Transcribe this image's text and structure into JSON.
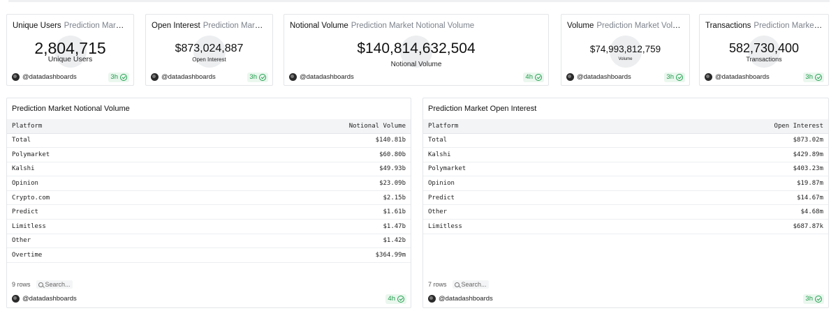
{
  "kpis": [
    {
      "title": "Unique Users",
      "subtitle": "Prediction Market Us...",
      "value": "2,804,715",
      "label": "Unique Users",
      "author": "@datadashboards",
      "freshness": "3h"
    },
    {
      "title": "Open Interest",
      "subtitle": "Prediction Market O...",
      "value": "$873,024,887",
      "label": "Open Interest",
      "author": "@datadashboards",
      "freshness": "3h"
    },
    {
      "title": "Notional Volume",
      "subtitle": "Prediction Market Notional Volume",
      "value": "$140,814,632,504",
      "label": "Notional Volume",
      "author": "@datadashboards",
      "freshness": "4h"
    },
    {
      "title": "Volume",
      "subtitle": "Prediction Market Volume",
      "value": "$74,993,812,759",
      "label": "Volume",
      "author": "@datadashboards",
      "freshness": "3h"
    },
    {
      "title": "Transactions",
      "subtitle": "Prediction Market Tra...",
      "value": "582,730,400",
      "label": "Transactions",
      "author": "@datadashboards",
      "freshness": "3h"
    }
  ],
  "tables": [
    {
      "title": "Prediction Market Notional Volume",
      "columns": [
        "Platform",
        "Notional Volume"
      ],
      "rows": [
        [
          "Total",
          "$140.81b"
        ],
        [
          "Polymarket",
          "$60.80b"
        ],
        [
          "Kalshi",
          "$49.93b"
        ],
        [
          "Opinion",
          "$23.09b"
        ],
        [
          "Crypto.com",
          "$2.15b"
        ],
        [
          "Predict",
          "$1.61b"
        ],
        [
          "Limitless",
          "$1.47b"
        ],
        [
          "Other",
          "$1.42b"
        ],
        [
          "Overtime",
          "$364.99m"
        ]
      ],
      "row_count": "9 rows",
      "search_placeholder": "Search...",
      "author": "@datadashboards",
      "freshness": "4h"
    },
    {
      "title": "Prediction Market Open Interest",
      "columns": [
        "Platform",
        "Open Interest"
      ],
      "rows": [
        [
          "Total",
          "$873.02m"
        ],
        [
          "Kalshi",
          "$429.89m"
        ],
        [
          "Polymarket",
          "$403.23m"
        ],
        [
          "Opinion",
          "$19.87m"
        ],
        [
          "Predict",
          "$14.67m"
        ],
        [
          "Other",
          "$4.68m"
        ],
        [
          "Limitless",
          "$687.87k"
        ]
      ],
      "row_count": "7 rows",
      "search_placeholder": "Search...",
      "author": "@datadashboards",
      "freshness": "3h"
    }
  ],
  "colors": {
    "fresh_green": "#1f9a4a",
    "border": "#e3e5e8",
    "header_bg": "#f3f4f6"
  },
  "icons": {
    "freshness": "check-circle-icon",
    "search": "search-icon",
    "author": "avatar"
  }
}
